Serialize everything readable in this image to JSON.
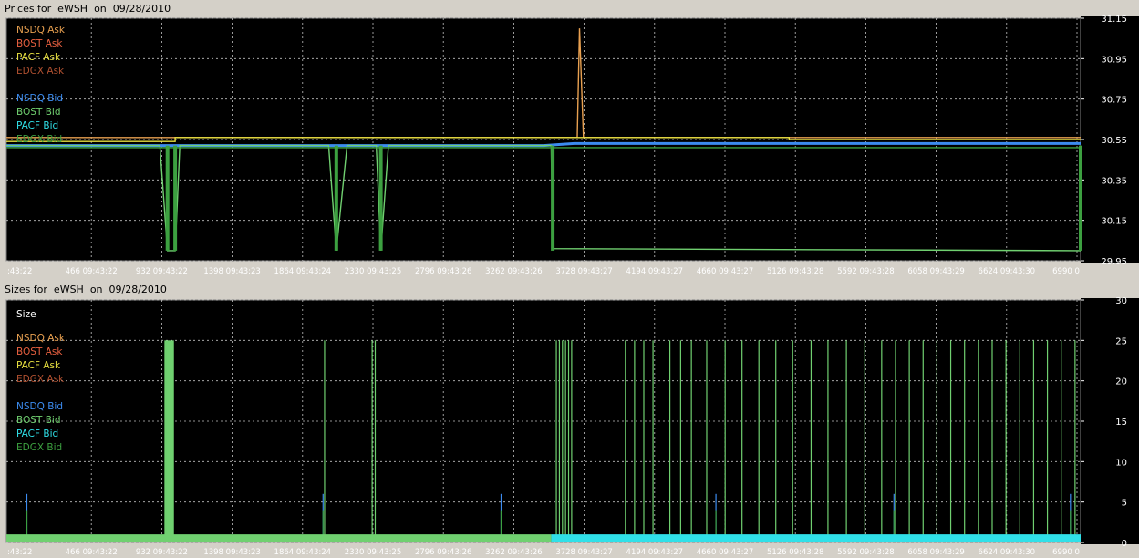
{
  "prices_panel": {
    "title": "Prices for  eWSH  on  09/28/2010"
  },
  "sizes_panel": {
    "title": "Sizes for  eWSH  on  09/28/2010",
    "legend_header": "Size"
  },
  "legend": [
    {
      "name": "NSDQ Ask",
      "color": "#e8a050"
    },
    {
      "name": "BOST Ask",
      "color": "#e86040"
    },
    {
      "name": "PACF Ask",
      "color": "#e8e040"
    },
    {
      "name": "EDGX Ask",
      "color": "#b05030"
    },
    {
      "name": "NSDQ Bid",
      "color": "#3c8cf0"
    },
    {
      "name": "BOST Bid",
      "color": "#70d070"
    },
    {
      "name": "PACF Bid",
      "color": "#30e0e8"
    },
    {
      "name": "EDGX Bid",
      "color": "#3ca040"
    }
  ],
  "x_ticks": [
    ":43:22",
    "466 09:43:22",
    "932 09:43:22",
    "1398 09:43:23",
    "1864 09:43:24",
    "2330 09:43:25",
    "2796 09:43:26",
    "3262 09:43:26",
    "3728 09:43:27",
    "4194 09:43:27",
    "4660 09:43:27",
    "5126 09:43:28",
    "5592 09:43:28",
    "6058 09:43:29",
    "6624 09:43:30",
    "6990 0"
  ],
  "chart_data": [
    {
      "type": "line",
      "title": "Prices for  eWSH  on  09/28/2010",
      "xlim": [
        0,
        7000
      ],
      "ylim": [
        29.95,
        31.15
      ],
      "y_ticks": [
        "31.15",
        "30.95",
        "30.75",
        "30.55",
        "30.35",
        "30.15",
        "29.95"
      ],
      "grid": true,
      "legend_position": "top-left",
      "series": [
        {
          "name": "NSDQ Ask",
          "x": [
            0,
            3700,
            3720,
            3735,
            3760,
            7000
          ],
          "values": [
            30.56,
            30.56,
            30.56,
            31.1,
            30.56,
            30.56
          ]
        },
        {
          "name": "PACF Ask",
          "x": [
            0,
            1100,
            1100,
            5100,
            5100,
            7000
          ],
          "values": [
            30.54,
            30.54,
            30.56,
            30.56,
            30.55,
            30.55
          ]
        },
        {
          "name": "NSDQ Bid",
          "x": [
            0,
            3500,
            3700,
            7000
          ],
          "values": [
            30.52,
            30.52,
            30.53,
            30.53
          ]
        },
        {
          "name": "BOST Bid",
          "x": [
            0,
            1000,
            1050,
            1100,
            1130,
            2100,
            2150,
            2220,
            2410,
            2440,
            2490,
            3550,
            3560,
            7000
          ],
          "values": [
            30.52,
            30.52,
            30.0,
            30.0,
            30.52,
            30.52,
            30.0,
            30.52,
            30.52,
            30.0,
            30.52,
            30.52,
            30.01,
            30.0
          ]
        },
        {
          "name": "EDGX Bid",
          "x": [
            0,
            7000
          ],
          "values": [
            30.51,
            30.51
          ]
        }
      ]
    },
    {
      "type": "bar",
      "title": "Sizes for  eWSH  on  09/28/2010",
      "xlim": [
        0,
        7000
      ],
      "ylim": [
        0,
        30
      ],
      "y_ticks": [
        "30",
        "25",
        "20",
        "15",
        "10",
        "5",
        "0"
      ],
      "grid": true,
      "legend_position": "top-left",
      "series": [
        {
          "name": "BOST Bid",
          "x": [
            1030,
            1040,
            1050,
            1060,
            1070,
            1080,
            2070,
            2380,
            2400,
            3580,
            3600,
            3620,
            3640,
            3660,
            3680,
            4030,
            4090,
            4150,
            4210,
            4320,
            4390,
            4460,
            4560,
            4680,
            4790,
            4900,
            5010,
            5120,
            5240,
            5350,
            5470,
            5590,
            5700,
            5790,
            5880,
            5970,
            6060,
            6150,
            6240,
            6330,
            6420,
            6510,
            6600,
            6690,
            6780,
            6870,
            6960
          ],
          "values": [
            25,
            25,
            25,
            25,
            25,
            25,
            25,
            25,
            25,
            25,
            25,
            25,
            25,
            25,
            25,
            25,
            25,
            25,
            25,
            25,
            25,
            25,
            25,
            25,
            25,
            25,
            25,
            25,
            25,
            25,
            25,
            25,
            25,
            25,
            25,
            25,
            25,
            25,
            25,
            25,
            25,
            25,
            25,
            25,
            25,
            25,
            25
          ]
        },
        {
          "name": "NSDQ Bid",
          "x": [
            130,
            2060,
            3220,
            4620,
            5780,
            6930
          ],
          "values": [
            6,
            6,
            6,
            6,
            6,
            6
          ]
        },
        {
          "name": "EDGX Bid",
          "x": [
            130,
            2060,
            3220,
            4620,
            5780,
            6930
          ],
          "values": [
            4,
            4,
            4,
            4,
            4,
            4
          ]
        },
        {
          "name": "BOST Bid",
          "x": [
            0,
            3550
          ],
          "values": [
            1,
            1
          ]
        },
        {
          "name": "PACF Bid",
          "x": [
            3550,
            7000
          ],
          "values": [
            1,
            1
          ]
        }
      ]
    }
  ]
}
